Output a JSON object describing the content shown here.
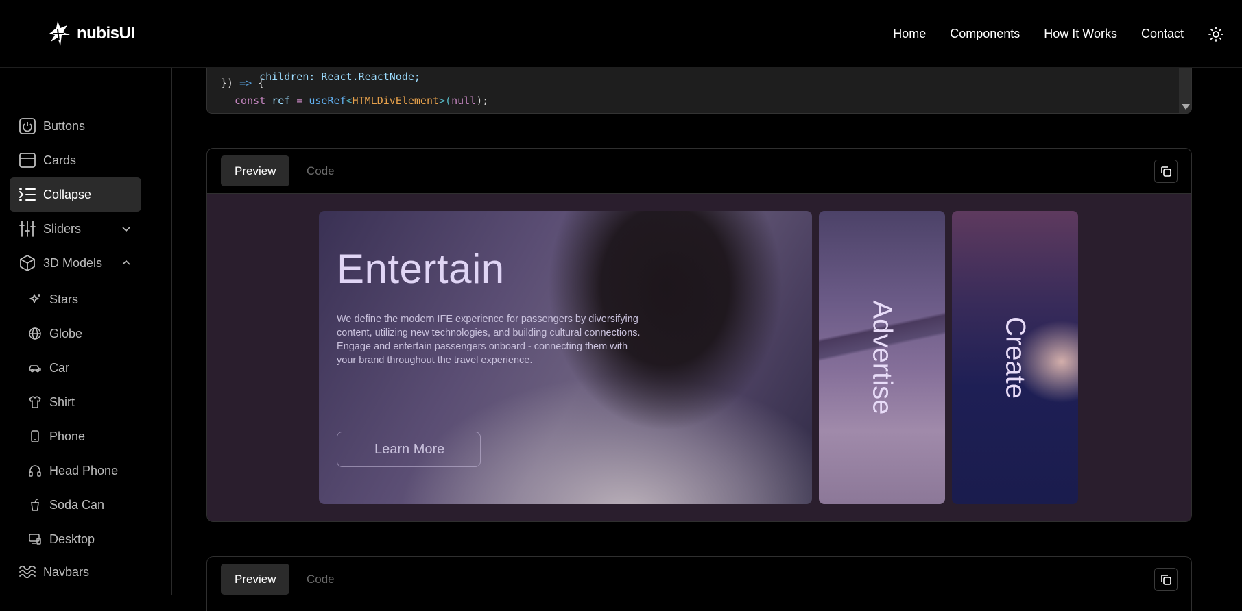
{
  "header": {
    "logo_text": "nubisUI",
    "nav": [
      "Home",
      "Components",
      "How It Works",
      "Contact"
    ]
  },
  "sidebar": {
    "items": [
      {
        "label": "Buttons",
        "icon": "power-icon"
      },
      {
        "label": "Cards",
        "icon": "inbox-icon"
      },
      {
        "label": "Collapse",
        "icon": "list-indent-icon",
        "active": true
      },
      {
        "label": "Sliders",
        "icon": "sliders-icon",
        "chevron": "down"
      },
      {
        "label": "3D Models",
        "icon": "cube-icon",
        "chevron": "up"
      }
    ],
    "sub_items": [
      {
        "label": "Stars",
        "icon": "sparkles-icon"
      },
      {
        "label": "Globe",
        "icon": "globe-icon"
      },
      {
        "label": "Car",
        "icon": "car-icon"
      },
      {
        "label": "Shirt",
        "icon": "shirt-icon"
      },
      {
        "label": "Phone",
        "icon": "phone-icon"
      },
      {
        "label": "Head Phone",
        "icon": "headphone-icon"
      },
      {
        "label": "Soda Can",
        "icon": "cup-icon"
      },
      {
        "label": "Desktop",
        "icon": "desktop-icon"
      }
    ],
    "bottom_item": {
      "label": "Navbars",
      "icon": "waves-icon"
    }
  },
  "code_snippet": {
    "line1": "children: React.ReactNode;",
    "line2_a": "})",
    "line2_b": " => ",
    "line2_c": "{",
    "line3_kw": "const",
    "line3_var": " ref ",
    "line3_eq": "= ",
    "line3_fn": "useRef",
    "line3_lt": "<",
    "line3_type": "HTMLDivElement",
    "line3_gt": ">(",
    "line3_null": "null",
    "line3_end": ");"
  },
  "panels": [
    {
      "preview_label": "Preview",
      "code_label": "Code"
    },
    {
      "preview_label": "Preview",
      "code_label": "Code"
    }
  ],
  "preview": {
    "main_card": {
      "title": "Entertain",
      "description": "We define the modern IFE experience for passengers by diversifying content, utilizing new technologies, and building cultural connections. Engage and entertain passengers onboard - connecting them with your brand throughout the travel experience.",
      "button": "Learn More"
    },
    "side_cards": [
      "Advertise",
      "Create"
    ]
  },
  "colors": {
    "background": "#000000",
    "preview_bg": "#2a1e2d",
    "active_item": "#2b2b2b",
    "code_bg": "#1e1e1e"
  }
}
